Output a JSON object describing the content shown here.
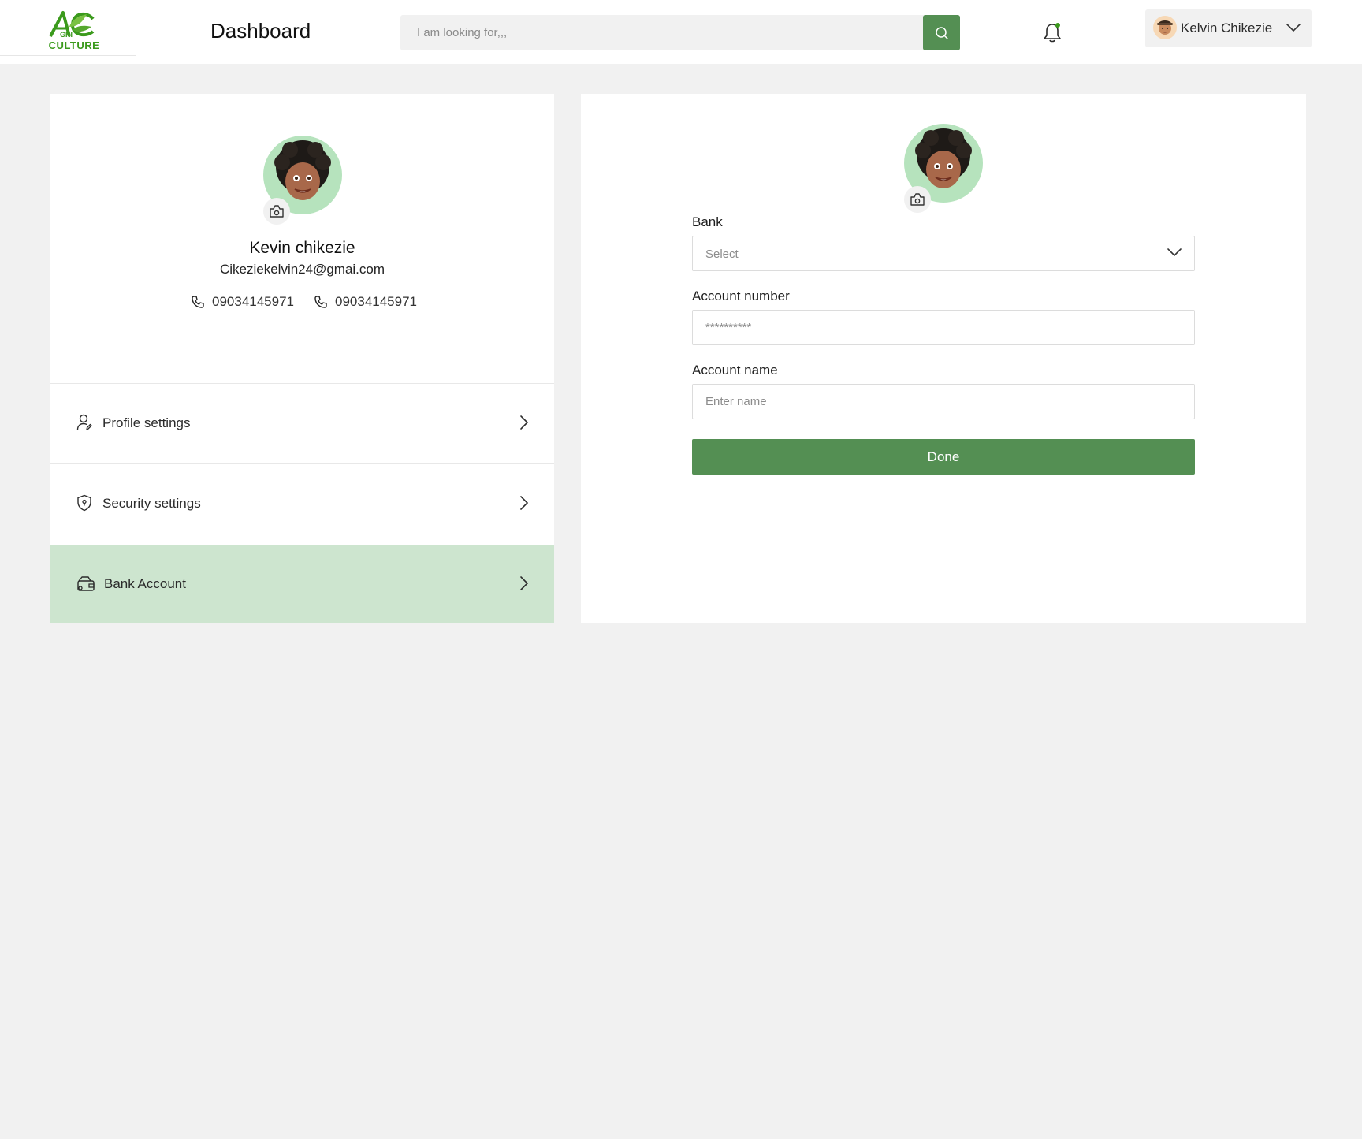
{
  "header": {
    "logo_text": "CULTURE",
    "logo_small": "GRI",
    "page_title": "Dashboard",
    "search_placeholder": "I am looking for,,,",
    "user_name": "Kelvin Chikezie"
  },
  "profile": {
    "name": "Kevin chikezie",
    "email": "Cikeziekelvin24@gmai.com",
    "phones": [
      "09034145971",
      "09034145971"
    ]
  },
  "menu": {
    "items": [
      {
        "label": "Profile settings",
        "icon": "user-edit-icon"
      },
      {
        "label": "Security settings",
        "icon": "shield-icon"
      },
      {
        "label": "Bank Account",
        "icon": "wallet-icon",
        "active": true
      }
    ]
  },
  "bank_form": {
    "bank_label": "Bank",
    "bank_value": "Select",
    "account_number_label": "Account number",
    "account_number_placeholder": "**********",
    "account_name_label": "Account name",
    "account_name_placeholder": "Enter name",
    "done_label": "Done"
  },
  "colors": {
    "accent": "#548f53",
    "active_row": "#cde5cf",
    "avatar_bg": "#b6e3bd",
    "page_bg": "#f1f1f1"
  }
}
